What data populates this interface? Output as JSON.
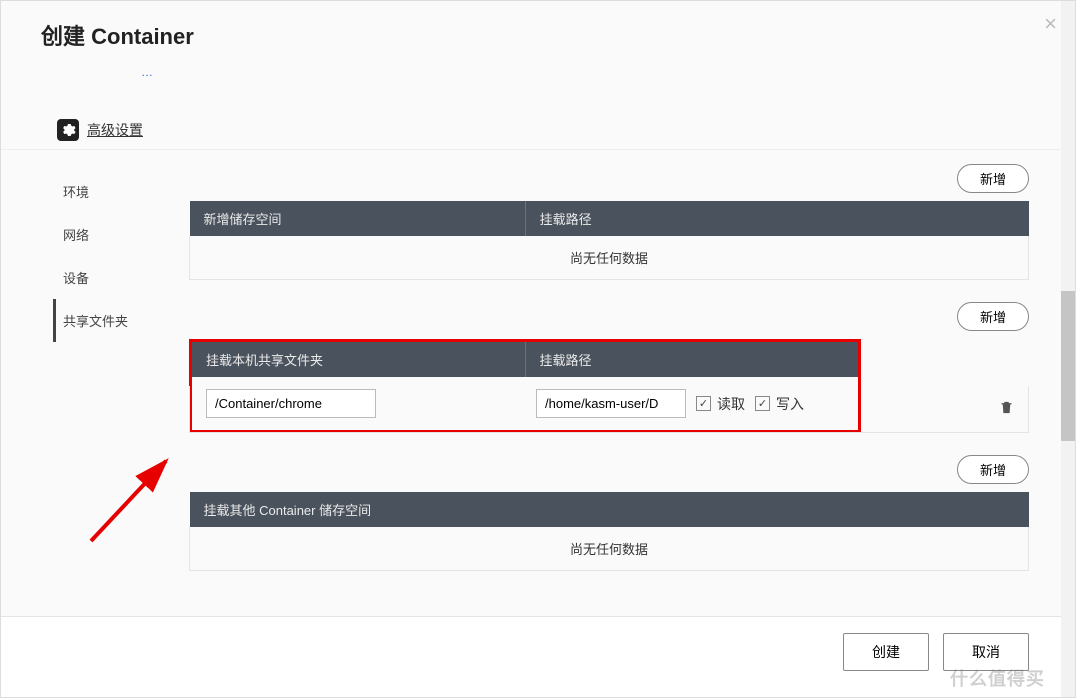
{
  "modal": {
    "title": "创建 Container",
    "blue_text": "…"
  },
  "section": {
    "title": "高级设置"
  },
  "tabs": [
    "环境",
    "网络",
    "设备",
    "共享文件夹"
  ],
  "active_tab_index": 3,
  "buttons": {
    "add": "新增",
    "create": "创建",
    "cancel": "取消"
  },
  "storage_table": {
    "h1": "新增储存空间",
    "h2": "挂载路径",
    "empty": "尚无任何数据"
  },
  "share_table": {
    "h1": "挂载本机共享文件夹",
    "h2": "挂载路径",
    "row": {
      "local": "/Container/chrome",
      "mount": "/home/kasm-user/D",
      "read": "读取",
      "write": "写入",
      "read_checked": true,
      "write_checked": true
    }
  },
  "other_table": {
    "h1": "挂载其他 Container 储存空间",
    "empty": "尚无任何数据"
  },
  "watermark": "什么值得买"
}
